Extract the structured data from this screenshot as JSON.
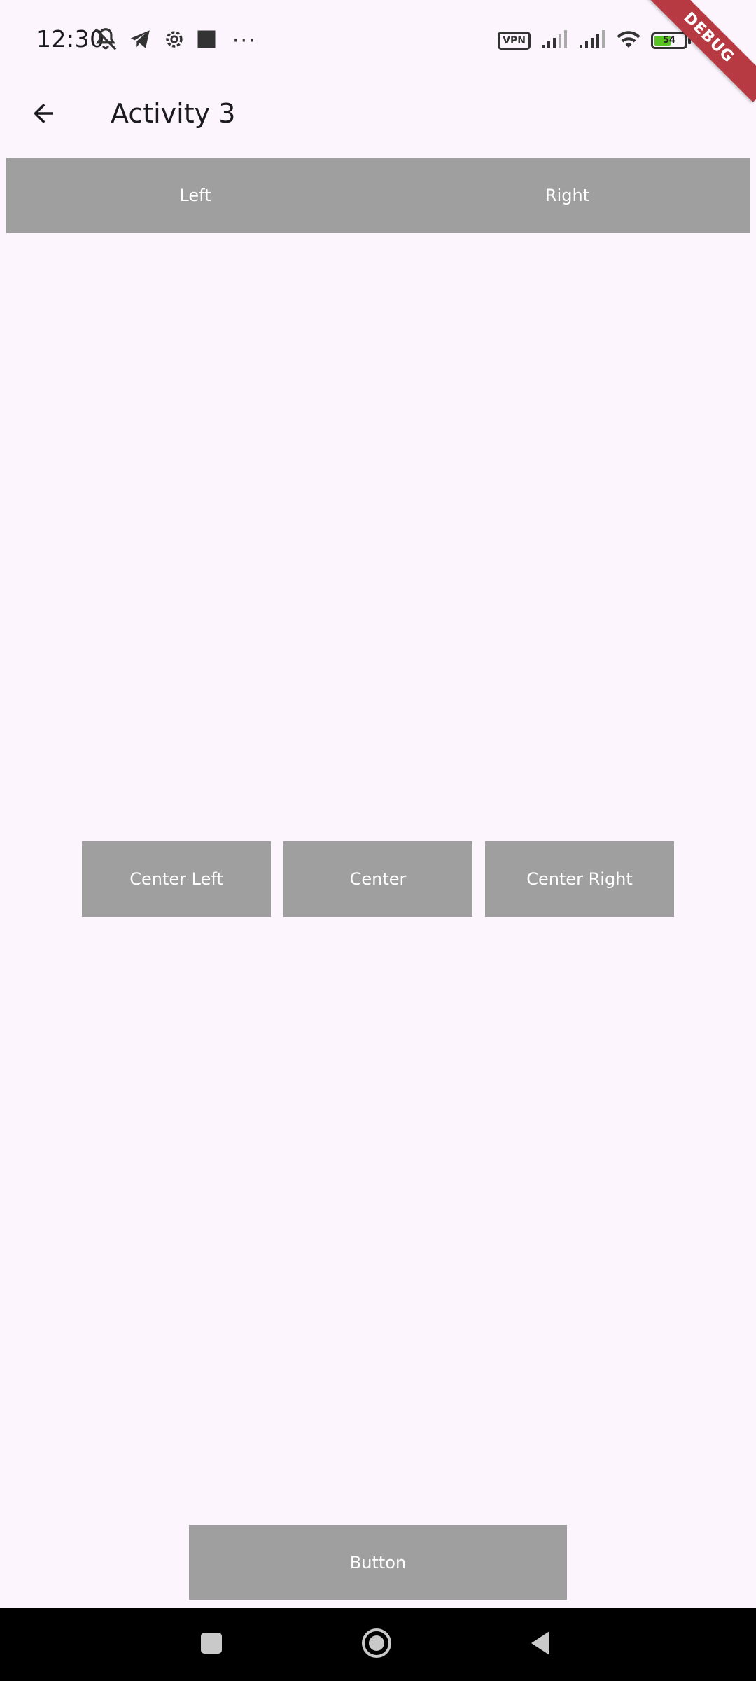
{
  "status_bar": {
    "time": "12:30",
    "more_dots": "···",
    "vpn_label": "VPN",
    "battery_level": "54",
    "battery_fraction": 0.54
  },
  "debug_banner": "DEBUG",
  "app_bar": {
    "title": "Activity 3",
    "back_icon": "arrow-back"
  },
  "top_row": {
    "left_label": "Left",
    "right_label": "Right"
  },
  "center_row": {
    "left_label": "Center Left",
    "center_label": "Center",
    "right_label": "Center Right"
  },
  "bottom": {
    "button_label": "Button"
  },
  "nav": {
    "recents_icon": "square",
    "home_icon": "circle",
    "back_icon": "triangle"
  },
  "colors": {
    "background": "#fcf5fd",
    "button": "#9f9f9f",
    "debug": "#b73a43",
    "battery": "#58c322"
  }
}
